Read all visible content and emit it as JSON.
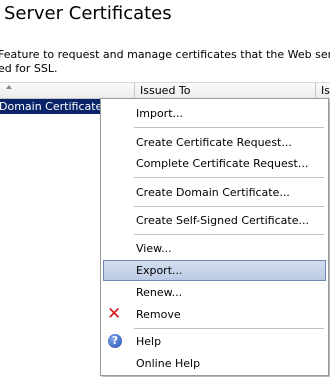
{
  "page": {
    "title": "Server Certificates",
    "description_line1": "Feature to request and manage certificates that the Web server can",
    "description_line2": "ed for SSL."
  },
  "list": {
    "columns": [
      "",
      "Issued To",
      "Is"
    ],
    "selected_row": "Domain Certificate"
  },
  "context_menu": {
    "items": [
      {
        "label": "Import..."
      },
      {
        "label": "Create Certificate Request..."
      },
      {
        "label": "Complete Certificate Request..."
      },
      {
        "label": "Create Domain Certificate..."
      },
      {
        "label": "Create Self-Signed Certificate..."
      },
      {
        "label": "View..."
      },
      {
        "label": "Export..."
      },
      {
        "label": "Renew..."
      },
      {
        "label": "Remove",
        "icon": "remove-icon"
      },
      {
        "label": "Help",
        "icon": "help-icon"
      },
      {
        "label": "Online Help"
      }
    ],
    "highlighted": "Export..."
  },
  "colors": {
    "selection": "#0a246a",
    "menu_highlight": "#c6d3ea",
    "remove_icon": "#d11a1a",
    "help_icon": "#1d4fb1"
  }
}
